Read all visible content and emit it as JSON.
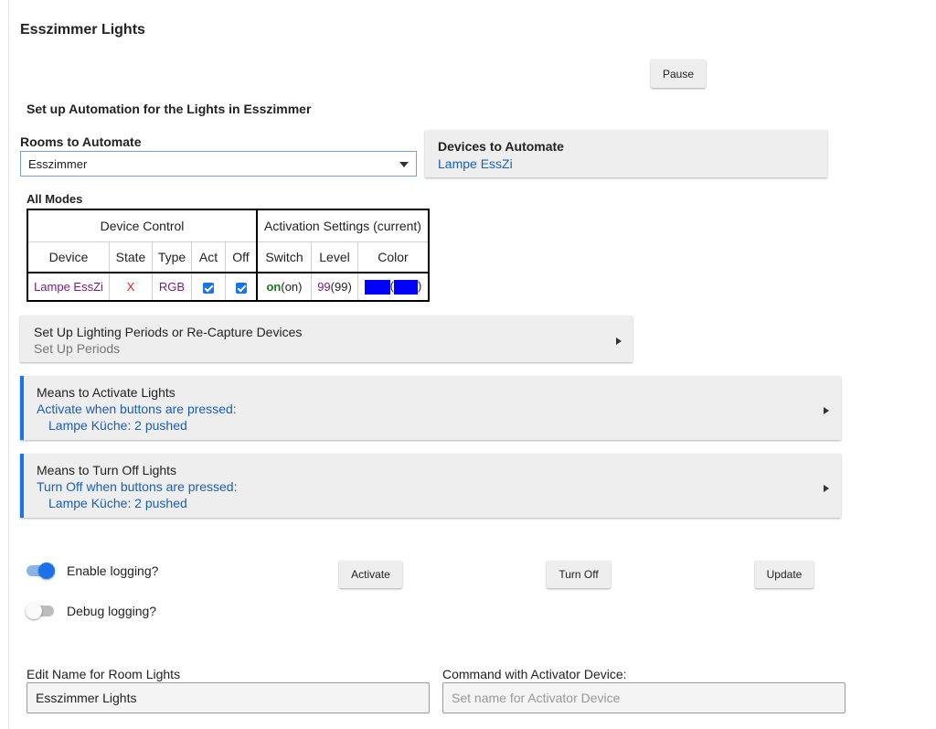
{
  "page": {
    "title": "Esszimmer Lights",
    "pause_label": "Pause",
    "subtitle": "Set up Automation for the Lights in Esszimmer"
  },
  "rooms": {
    "label": "Rooms to Automate",
    "selected": "Esszimmer"
  },
  "devices_card": {
    "title": "Devices to Automate",
    "value": "Lampe EssZi"
  },
  "modes": {
    "label": "All Modes",
    "group_device_control": "Device Control",
    "group_activation": "Activation Settings (current)",
    "headers": [
      "Device",
      "State",
      "Type",
      "Act",
      "Off",
      "Switch",
      "Level",
      "Color"
    ],
    "row": {
      "device": "Lampe EssZi",
      "state": "X",
      "type": "RGB",
      "act_checked": true,
      "off_checked": true,
      "switch_value": "on",
      "switch_current": "(on)",
      "level_value": "99",
      "level_current": "(99)",
      "color_hex": "#0000ff",
      "paren_open": "(",
      "paren_close": ")"
    }
  },
  "periods": {
    "title": "Set Up Lighting Periods or Re-Capture Devices",
    "subtitle": "Set Up Periods"
  },
  "activate_section": {
    "title": "Means to Activate Lights",
    "line1": "Activate when buttons are pressed:",
    "line2": "Lampe Küche: 2 pushed"
  },
  "turnoff_section": {
    "title": "Means to Turn Off Lights",
    "line1": "Turn Off when buttons are pressed:",
    "line2": "Lampe Küche: 2 pushed"
  },
  "logging": {
    "enable_label": "Enable logging?",
    "enable_on": true,
    "debug_label": "Debug logging?",
    "debug_on": false
  },
  "actions": {
    "activate": "Activate",
    "turn_off": "Turn Off",
    "update": "Update"
  },
  "name_field": {
    "label": "Edit Name for Room Lights",
    "value": "Esszimmer Lights"
  },
  "command_field": {
    "label": "Command with Activator Device:",
    "placeholder": "Set name for Activator Device"
  },
  "colors": {
    "accent": "#1a73e8",
    "link": "#1a5fb4",
    "purple": "#7a1a7a",
    "red": "#e02020",
    "green": "#1a7a1a"
  }
}
